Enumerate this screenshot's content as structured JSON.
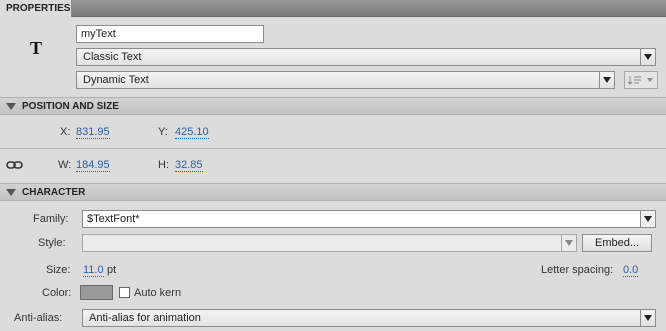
{
  "panel": {
    "tab_title": "PROPERTIES"
  },
  "instance": {
    "tool_icon": "T",
    "name_value": "myText",
    "engine": "Classic Text",
    "text_type": "Dynamic Text"
  },
  "position_size": {
    "title": "POSITION AND SIZE",
    "x_label": "X:",
    "x_value": "831.95",
    "y_label": "Y:",
    "y_value": "425.10",
    "w_label": "W:",
    "w_value": "184.95",
    "h_label": "H:",
    "h_value": "32.85"
  },
  "character": {
    "title": "CHARACTER",
    "family_label": "Family:",
    "family_value": "$TextFont*",
    "style_label": "Style:",
    "style_value": "",
    "embed_label": "Embed...",
    "size_label": "Size:",
    "size_value": "11.0",
    "size_unit": "pt",
    "letter_spacing_label": "Letter spacing:",
    "letter_spacing_value": "0.0",
    "color_label": "Color:",
    "color_value": "#9a9a9a",
    "auto_kern_label": "Auto kern",
    "antialias_label": "Anti-alias:",
    "antialias_value": "Anti-alias for animation"
  }
}
